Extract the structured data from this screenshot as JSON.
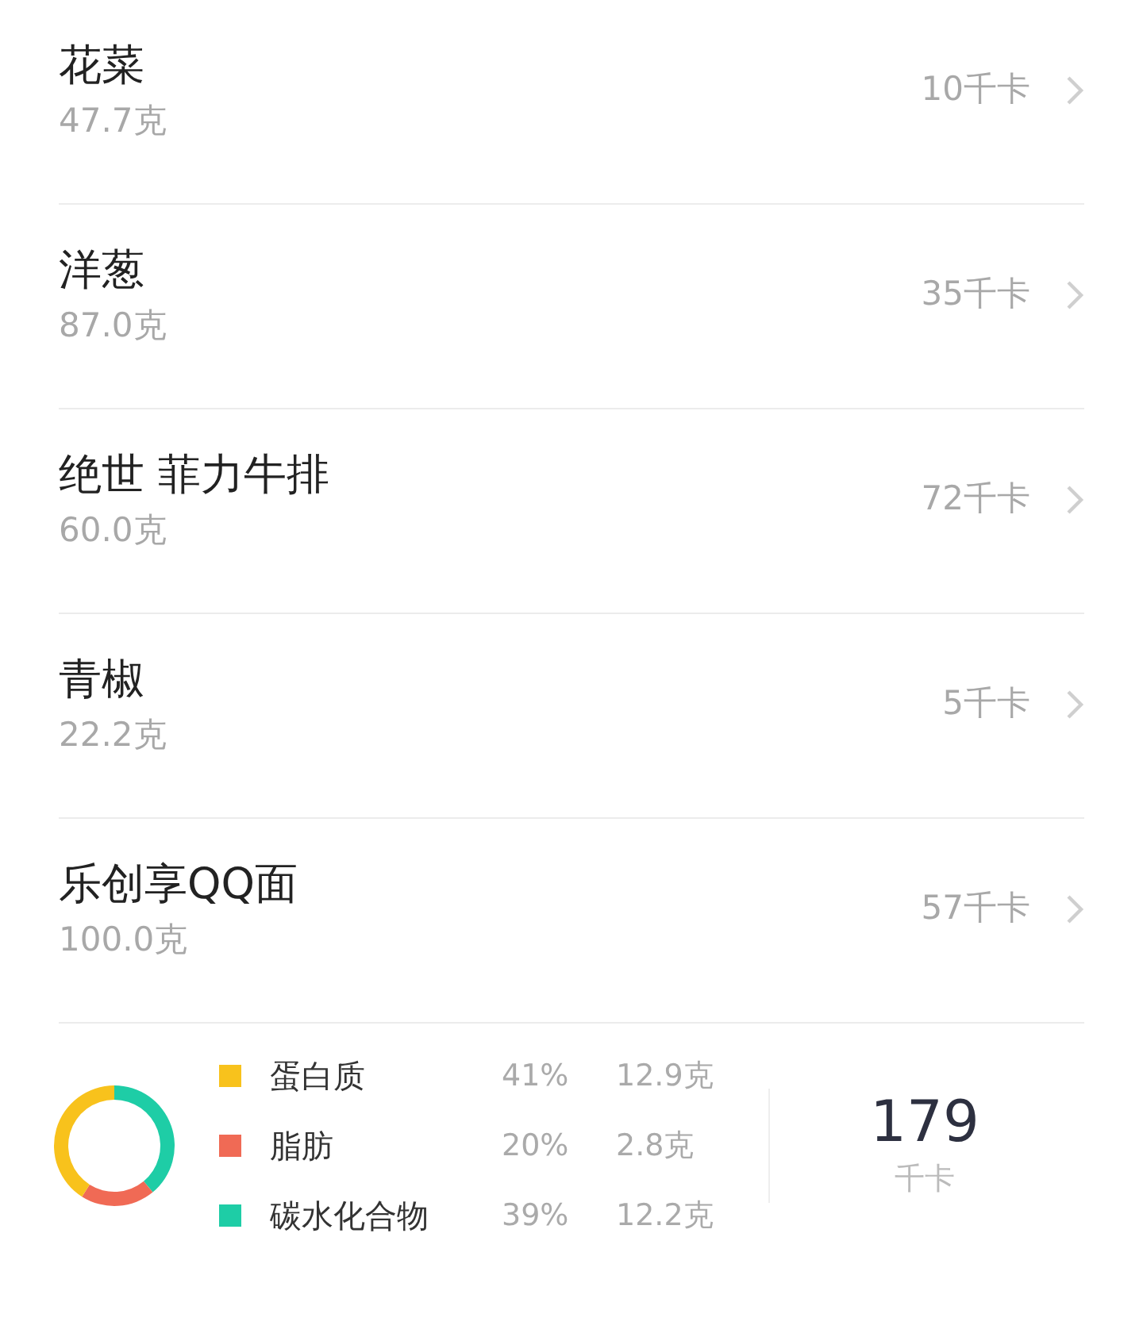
{
  "foods": [
    {
      "name": "花菜",
      "weight": "47.7克",
      "calories": "10千卡"
    },
    {
      "name": "洋葱",
      "weight": "87.0克",
      "calories": "35千卡"
    },
    {
      "name": "绝世 菲力牛排",
      "weight": "60.0克",
      "calories": "72千卡"
    },
    {
      "name": "青椒",
      "weight": "22.2克",
      "calories": "5千卡"
    },
    {
      "name": "乐创享QQ面",
      "weight": "100.0克",
      "calories": "57千卡"
    }
  ],
  "summary": {
    "nutrients": [
      {
        "name": "蛋白质",
        "percent": "41%",
        "amount": "12.9克",
        "color": "#f8c21c"
      },
      {
        "name": "脂肪",
        "percent": "20%",
        "amount": "2.8克",
        "color": "#f06a55"
      },
      {
        "name": "碳水化合物",
        "percent": "39%",
        "amount": "12.2克",
        "color": "#1ecda6"
      }
    ],
    "total": "179",
    "total_unit": "千卡"
  }
}
